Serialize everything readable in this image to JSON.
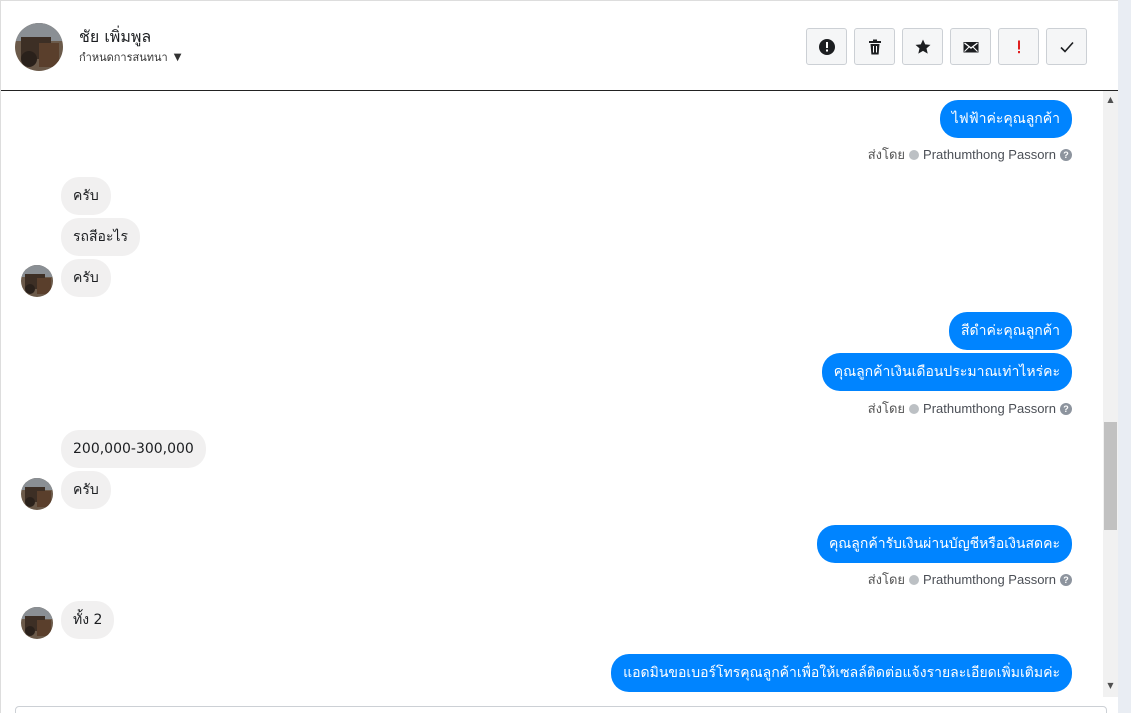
{
  "header": {
    "contact_name": "ชัย เพิ่มพูล",
    "subtitle": "กำหนดการสนทนา",
    "actions": [
      {
        "name": "report-button",
        "icon": "alert-circle-icon",
        "glyph": "!"
      },
      {
        "name": "delete-button",
        "icon": "trash-icon"
      },
      {
        "name": "star-button",
        "icon": "star-icon"
      },
      {
        "name": "mark-unread-button",
        "icon": "envelope-icon"
      },
      {
        "name": "important-button",
        "icon": "exclamation-icon",
        "glyph": "!"
      },
      {
        "name": "done-button",
        "icon": "check-icon",
        "glyph": "✓"
      }
    ]
  },
  "messages": {
    "m1": "ไฟฟ้าค่ะคุณลูกค้า",
    "m2": "ครับ",
    "m3": "รถสีอะไร",
    "m4": "ครับ",
    "m5": "สีดำค่ะคุณลูกค้า",
    "m6": "คุณลูกค้าเงินเดือนประมาณเท่าไหร่คะ",
    "m7": "200,000-300,000",
    "m8": "ครับ",
    "m9": "คุณลูกค้ารับเงินผ่านบัญชีหรือเงินสดคะ",
    "m10": "ทั้ง 2",
    "m11": "แอดมินขอเบอร์โทรคุณลูกค้าเพื่อให้เซลล์ติดต่อแจ้งรายละเอียดเพิ่มเติมค่ะ"
  },
  "sent_by": {
    "label": "ส่งโดย",
    "agent": "Prathumthong Passorn",
    "help": "?"
  },
  "scrollbar": {
    "up": "▲",
    "down": "▼"
  },
  "colors": {
    "outgoing": "#0084ff",
    "incoming": "#f1f0f0",
    "important": "#e02020"
  }
}
